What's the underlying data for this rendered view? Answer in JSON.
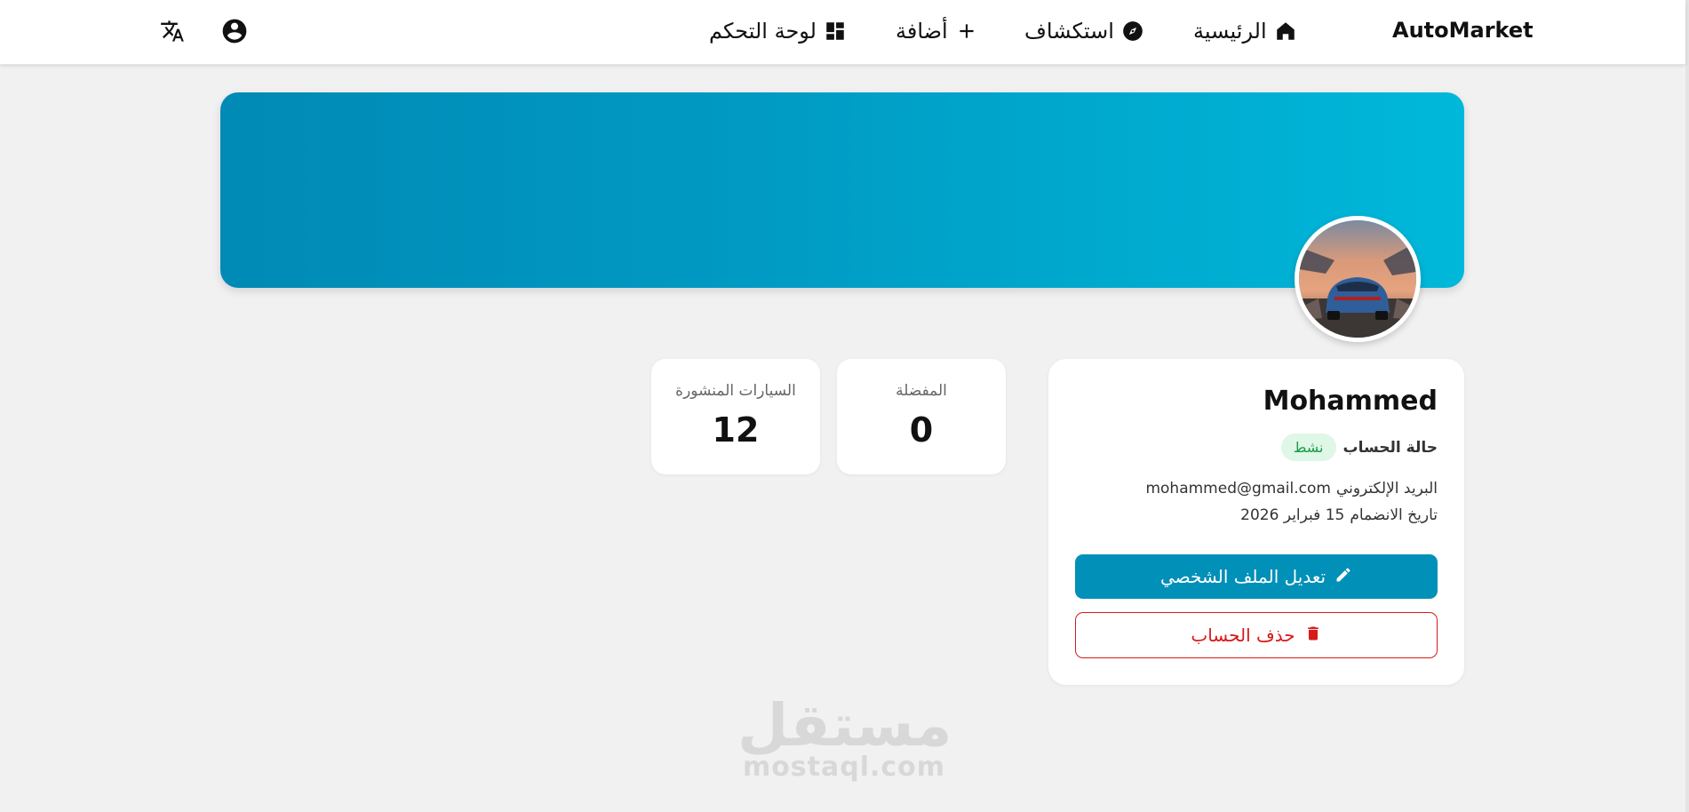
{
  "nav": {
    "brand": "AutoMarket",
    "home_label": "الرئيسية",
    "explore_label": "استكشاف",
    "add_label": "أضافة",
    "dashboard_label": "لوحة التحكم"
  },
  "profile": {
    "name": "Mohammed",
    "status_label": "حالة الحساب",
    "status_value": "نشط",
    "email_label": "البريد الإلكتروني",
    "email_value": "mohammed@gmail.com",
    "join_label": "تاريخ الانضمام",
    "join_value": "15 فبراير 2026",
    "edit_button": "تعديل الملف الشخصي",
    "delete_button": "حذف الحساب"
  },
  "stats": {
    "favorites_label": "المفضلة",
    "favorites_value": "0",
    "cars_label": "السيارات المنشورة",
    "cars_value": "12"
  },
  "watermark": {
    "arabic": "مستقل",
    "latin": "mostaql.com"
  },
  "colors": {
    "primary": "#0090b8",
    "danger": "#d71a1a",
    "status_bg": "#dff7e6",
    "status_fg": "#1a9a48"
  }
}
